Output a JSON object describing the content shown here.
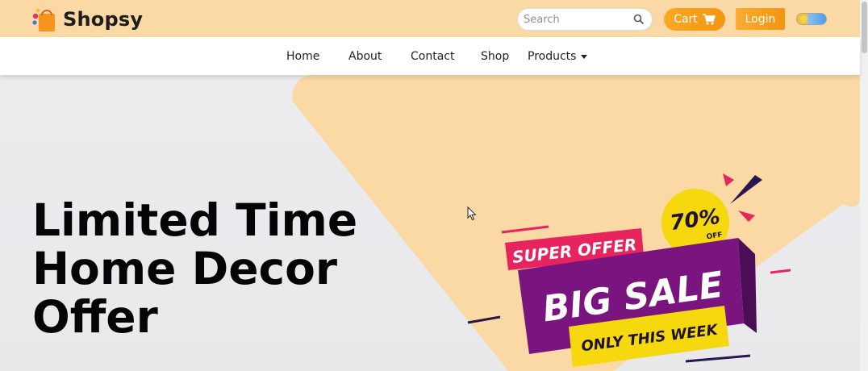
{
  "brand": {
    "name": "Shopsy",
    "accent_color": "#f9a826",
    "topbar_color": "#fbd9a4"
  },
  "search": {
    "placeholder": "Search",
    "value": ""
  },
  "header": {
    "cart_label": "Cart",
    "login_label": "Login",
    "theme_toggle": "light-dark-toggle"
  },
  "nav": {
    "items": [
      "Home",
      "About",
      "Contact",
      "Shop",
      "Products"
    ]
  },
  "hero": {
    "title_lines": [
      "Limited Time",
      "Home Decor",
      "Offer"
    ],
    "badge": {
      "super_offer": "SUPER OFFER",
      "big_sale": "BIG SALE",
      "only_this_week": "ONLY THIS WEEK",
      "percent": "70%",
      "off": "OFF"
    }
  },
  "icons": [
    "shopping-bag-logo-icon",
    "search-icon",
    "cart-icon",
    "chevron-down-icon",
    "mouse-cursor-icon"
  ]
}
